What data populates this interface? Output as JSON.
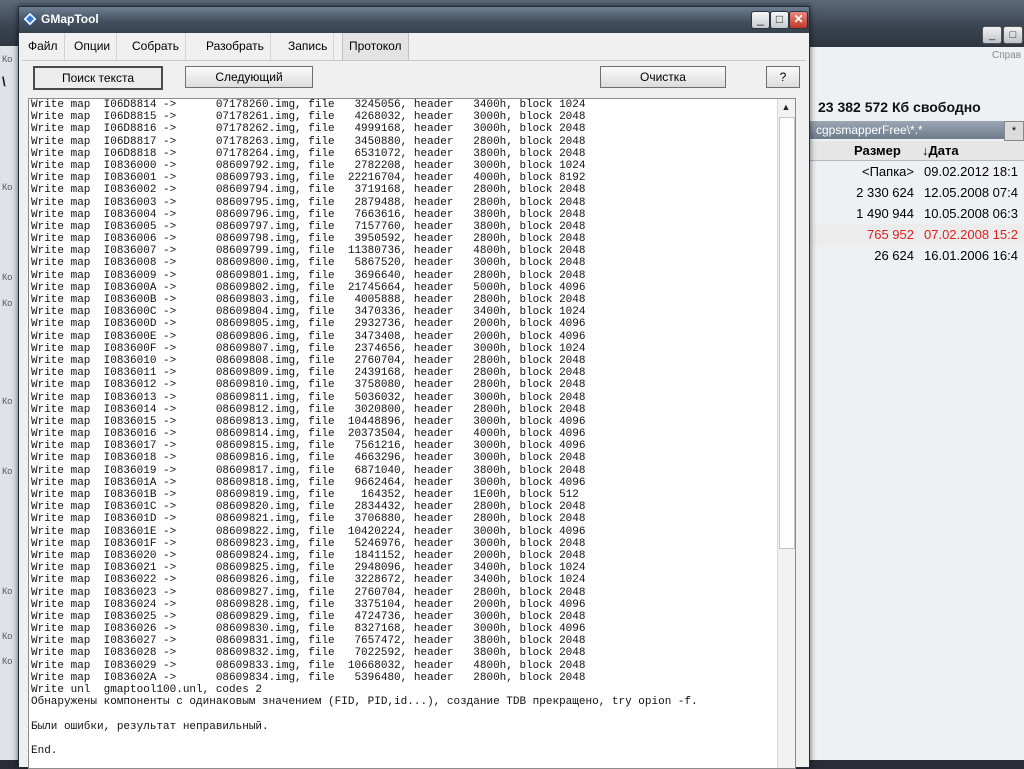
{
  "background_app": {
    "help_menu": "Справ",
    "left_labels": [
      "Ко",
      "Ко",
      "Ко",
      "Ко",
      "Ко",
      "Ко",
      "Ко",
      "Ко",
      "Ко"
    ],
    "left_marker": "\\",
    "free_space": "23 382 572 Кб свободно",
    "path": "cgpsmapperFree\\*.*",
    "filter": "*",
    "columns": {
      "size": "Размер",
      "date": "↓Дата"
    },
    "rows": [
      {
        "size": "<Папка>",
        "date": "09.02.2012 18:1"
      },
      {
        "size": "2 330 624",
        "date": "12.05.2008 07:4"
      },
      {
        "size": "1 490 944",
        "date": "10.05.2008 06:3"
      },
      {
        "size": "765 952",
        "date": "07.02.2008 15:2"
      },
      {
        "size": "26 624",
        "date": "16.01.2006 16:4"
      }
    ],
    "controls": [
      "_",
      "□",
      "×"
    ]
  },
  "window": {
    "title": "GMapTool",
    "controls": {
      "minimize": "_",
      "maximize": "□",
      "close": "✕"
    }
  },
  "menu": [
    "Файл",
    "Опции",
    "Собрать",
    "Разобрать",
    "Запись",
    "Протокол"
  ],
  "toolbar": {
    "search": "Поиск текста",
    "next": "Следующий",
    "clear": "Очистка",
    "help": "?"
  },
  "log": {
    "lines": [
      "Write map  I06D8814 ->      07178260.img, file   3245056, header   3400h, block 1024",
      "Write map  I06D8815 ->      07178261.img, file   4268032, header   3000h, block 2048",
      "Write map  I06D8816 ->      07178262.img, file   4999168, header   3000h, block 2048",
      "Write map  I06D8817 ->      07178263.img, file   3450880, header   2800h, block 2048",
      "Write map  I06D8818 ->      07178264.img, file   6531072, header   3800h, block 2048",
      "Write map  I0836000 ->      08609792.img, file   2782208, header   3000h, block 1024",
      "Write map  I0836001 ->      08609793.img, file  22216704, header   4000h, block 8192",
      "Write map  I0836002 ->      08609794.img, file   3719168, header   2800h, block 2048",
      "Write map  I0836003 ->      08609795.img, file   2879488, header   2800h, block 2048",
      "Write map  I0836004 ->      08609796.img, file   7663616, header   3800h, block 2048",
      "Write map  I0836005 ->      08609797.img, file   7157760, header   3800h, block 2048",
      "Write map  I0836006 ->      08609798.img, file   3950592, header   2800h, block 2048",
      "Write map  I0836007 ->      08609799.img, file  11380736, header   4800h, block 2048",
      "Write map  I0836008 ->      08609800.img, file   5867520, header   3000h, block 2048",
      "Write map  I0836009 ->      08609801.img, file   3696640, header   2800h, block 2048",
      "Write map  I083600A ->      08609802.img, file  21745664, header   5000h, block 4096",
      "Write map  I083600B ->      08609803.img, file   4005888, header   2800h, block 2048",
      "Write map  I083600C ->      08609804.img, file   3470336, header   3400h, block 1024",
      "Write map  I083600D ->      08609805.img, file   2932736, header   2000h, block 4096",
      "Write map  I083600E ->      08609806.img, file   3473408, header   2000h, block 4096",
      "Write map  I083600F ->      08609807.img, file   2374656, header   3000h, block 1024",
      "Write map  I0836010 ->      08609808.img, file   2760704, header   2800h, block 2048",
      "Write map  I0836011 ->      08609809.img, file   2439168, header   2800h, block 2048",
      "Write map  I0836012 ->      08609810.img, file   3758080, header   2800h, block 2048",
      "Write map  I0836013 ->      08609811.img, file   5036032, header   3000h, block 2048",
      "Write map  I0836014 ->      08609812.img, file   3020800, header   2800h, block 2048",
      "Write map  I0836015 ->      08609813.img, file  10448896, header   3000h, block 4096",
      "Write map  I0836016 ->      08609814.img, file  20373504, header   4000h, block 4096",
      "Write map  I0836017 ->      08609815.img, file   7561216, header   3000h, block 4096",
      "Write map  I0836018 ->      08609816.img, file   4663296, header   3000h, block 2048",
      "Write map  I0836019 ->      08609817.img, file   6871040, header   3800h, block 2048",
      "Write map  I083601A ->      08609818.img, file   9662464, header   3000h, block 4096",
      "Write map  I083601B ->      08609819.img, file    164352, header   1E00h, block 512",
      "Write map  I083601C ->      08609820.img, file   2834432, header   2800h, block 2048",
      "Write map  I083601D ->      08609821.img, file   3706880, header   2800h, block 2048",
      "Write map  I083601E ->      08609822.img, file  10420224, header   3000h, block 4096",
      "Write map  I083601F ->      08609823.img, file   5246976, header   3000h, block 2048",
      "Write map  I0836020 ->      08609824.img, file   1841152, header   2000h, block 2048",
      "Write map  I0836021 ->      08609825.img, file   2948096, header   3400h, block 1024",
      "Write map  I0836022 ->      08609826.img, file   3228672, header   3400h, block 1024",
      "Write map  I0836023 ->      08609827.img, file   2760704, header   2800h, block 2048",
      "Write map  I0836024 ->      08609828.img, file   3375104, header   2000h, block 4096",
      "Write map  I0836025 ->      08609829.img, file   4724736, header   3000h, block 2048",
      "Write map  I0836026 ->      08609830.img, file   8327168, header   3000h, block 4096",
      "Write map  I0836027 ->      08609831.img, file   7657472, header   3800h, block 2048",
      "Write map  I0836028 ->      08609832.img, file   7022592, header   3800h, block 2048",
      "Write map  I0836029 ->      08609833.img, file  10668032, header   4800h, block 2048",
      "Write map  I083602A ->      08609834.img, file   5396480, header   2800h, block 2048",
      "Write unl  gmaptool100.unl, codes 2",
      "Обнаружены компоненты с одинаковым значением (FID, PID,id...), создание TDB прекращено, try opion -f.",
      "",
      "Были ошибки, результат неправильный.",
      "",
      "End."
    ]
  },
  "colors": {
    "error_row": "#e02020",
    "titlebar": "#43505f"
  }
}
